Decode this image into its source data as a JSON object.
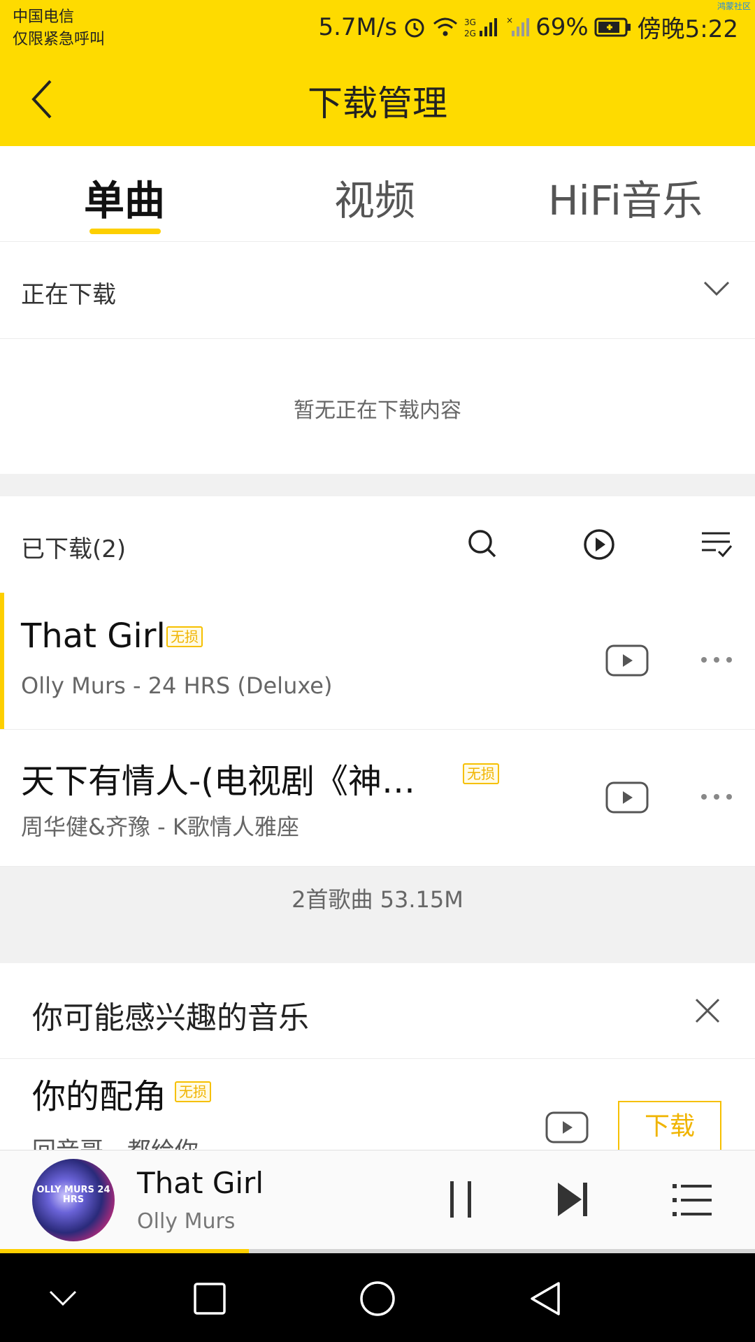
{
  "status_bar": {
    "carrier_line1": "中国电信",
    "carrier_line2": "仅限紧急呼叫",
    "net_speed": "5.7M/s",
    "battery": "69%",
    "time": "傍晚5:22",
    "corner_tag": "鸿蒙社区"
  },
  "header": {
    "title": "下载管理"
  },
  "tabs": [
    {
      "label": "单曲"
    },
    {
      "label": "视频"
    },
    {
      "label": "HiFi音乐"
    }
  ],
  "downloading": {
    "label": "正在下载",
    "empty_text": "暂无正在下载内容"
  },
  "downloaded": {
    "label": "已下载(2)",
    "songs": [
      {
        "title": "That Girl",
        "badge": "无损",
        "subtitle": "Olly Murs - 24 HRS (Deluxe)"
      },
      {
        "title": "天下有情人-(电视剧《神…",
        "badge": "无损",
        "subtitle": "周华健&齐豫 - K歌情人雅座"
      }
    ],
    "summary": "2首歌曲 53.15M"
  },
  "recommend": {
    "title": "你可能感兴趣的音乐",
    "song_title": "你的配角",
    "badge": "无损",
    "song_subtitle": "回音哥 - 都给你",
    "download_label": "下载"
  },
  "player": {
    "title": "That Girl",
    "artist": "Olly Murs",
    "album_text": "OLLY MURS 24 HRS",
    "progress": 0.33
  },
  "colors": {
    "accent": "#fedb00",
    "badge": "#f0b400"
  }
}
